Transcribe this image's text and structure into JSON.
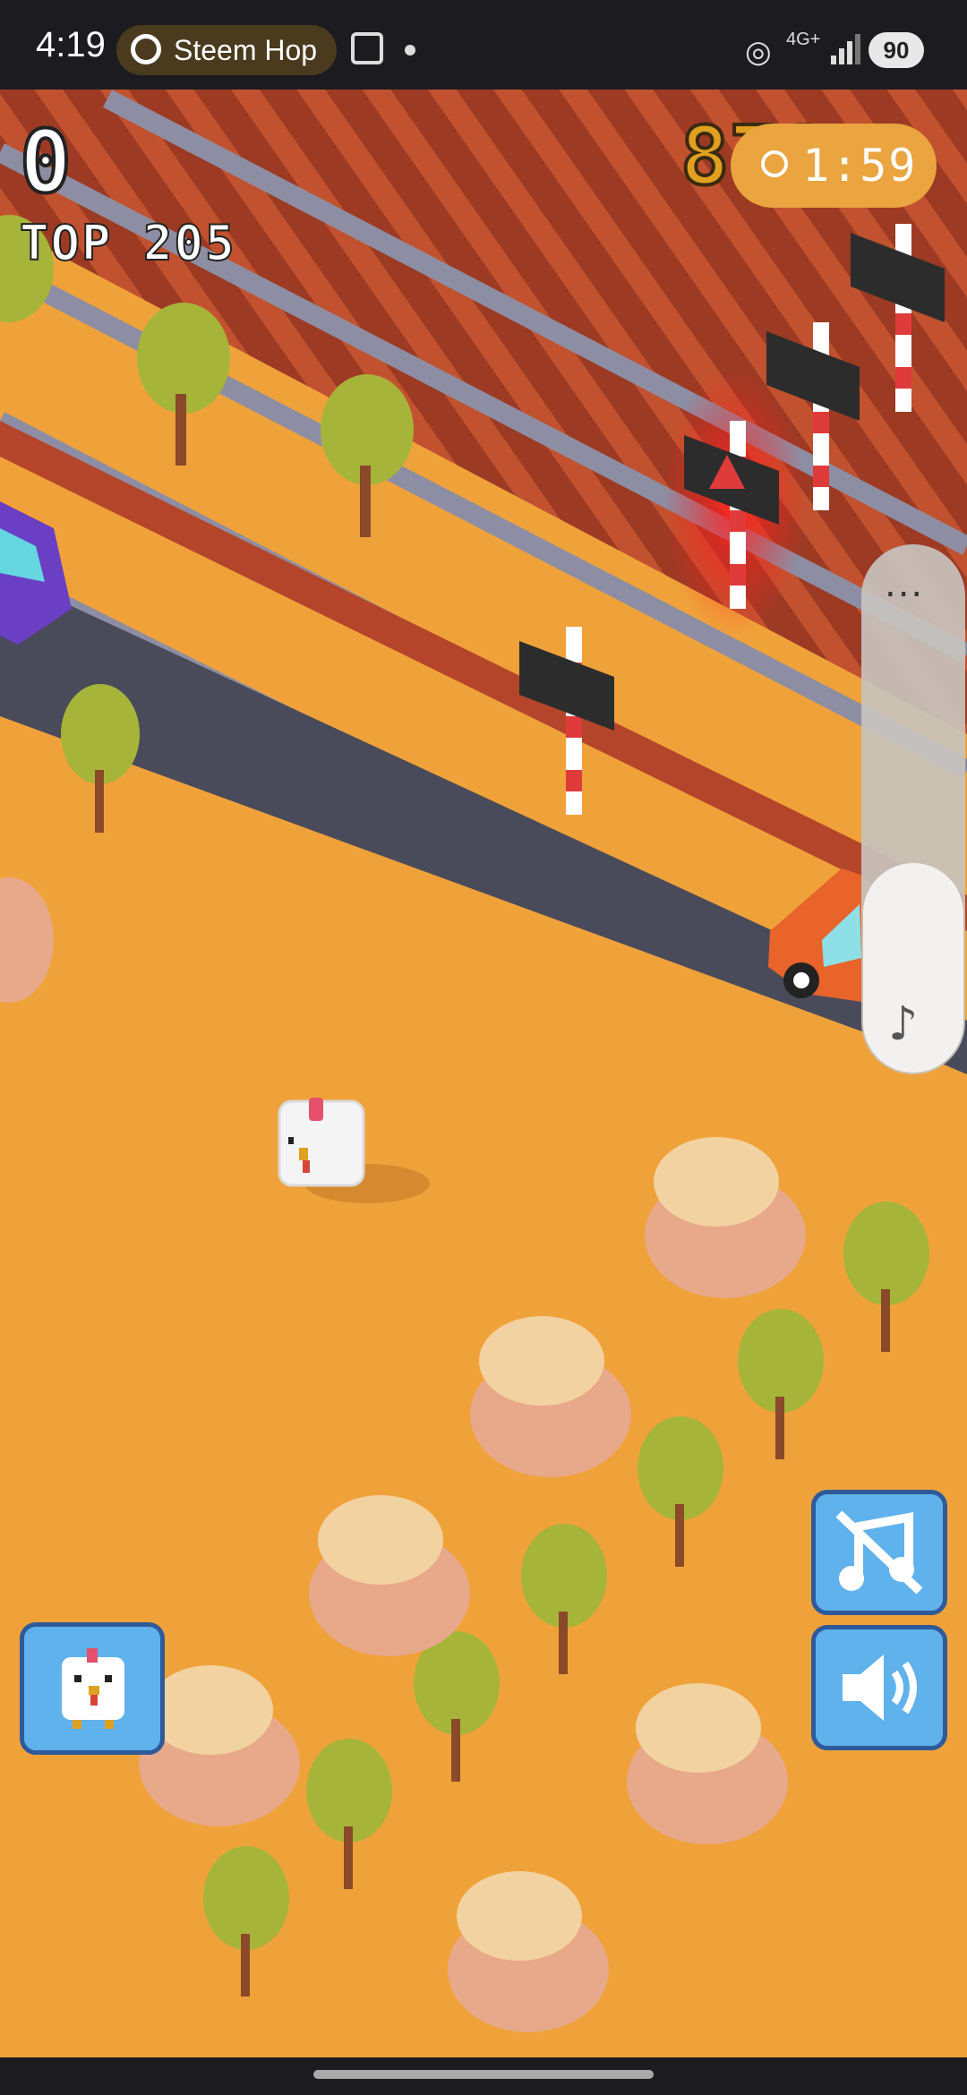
{
  "status_bar": {
    "time": "4:19",
    "app_pill_label": "Steem Hop",
    "network_label": "4G+",
    "battery": "90"
  },
  "hud": {
    "score": "0",
    "top_score": "TOP 205",
    "coins": "871",
    "timer": "1:59"
  },
  "side_panel": {
    "more_label": "..."
  },
  "colors": {
    "ground": "#f0a23a",
    "rail_planks": "#b5452a",
    "rail_metal": "#8d8ea3",
    "road": "#4a4b5a",
    "button": "#5fb2ec",
    "button_border": "#2f5a9a"
  },
  "icons": {
    "music_button": "music-off-icon",
    "sound_button": "speaker-on-icon",
    "character_button": "chicken-icon",
    "timer": "stopwatch-icon"
  }
}
